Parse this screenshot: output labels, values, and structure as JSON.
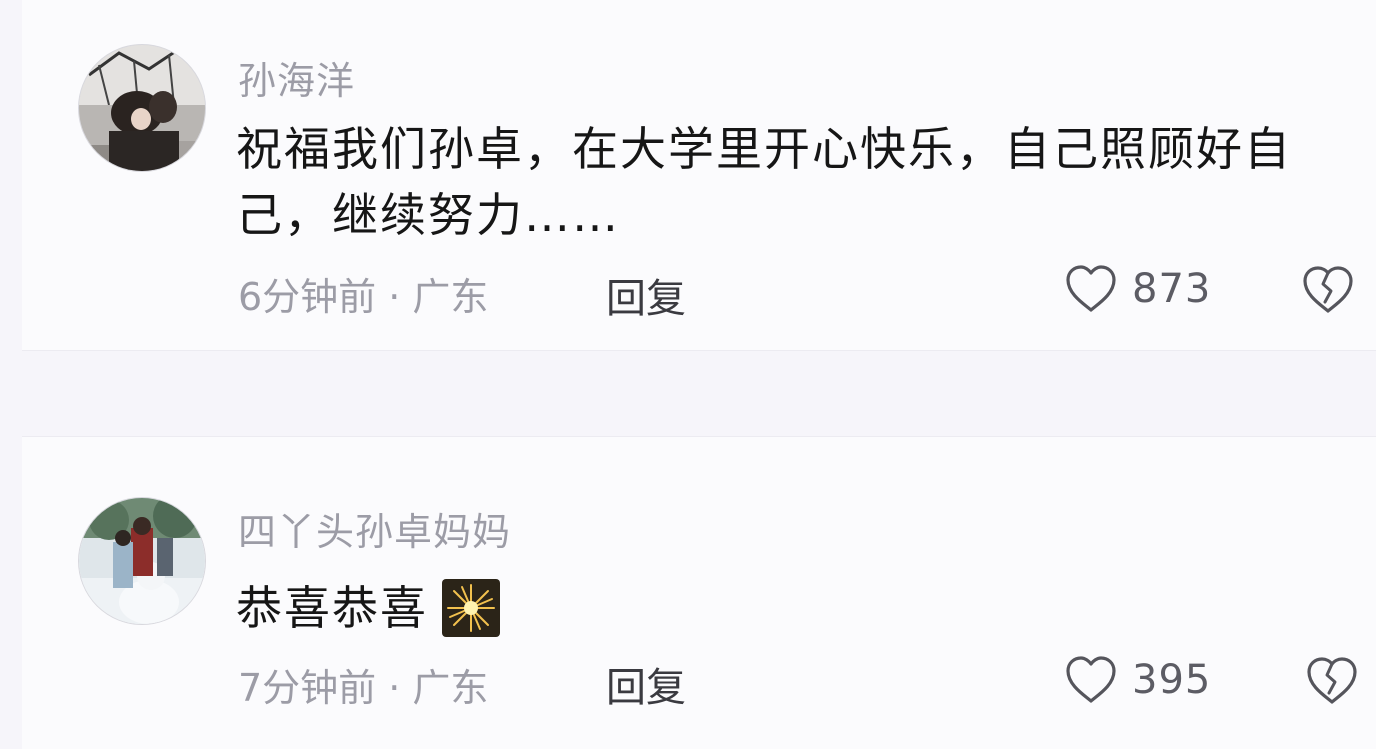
{
  "comments": [
    {
      "username": "孙海洋",
      "text": "祝福我们孙卓，在大学里开心快乐，自己照顾好自己，继续努力……",
      "meta": "6分钟前 · 广东",
      "reply_label": "回复",
      "like_count": "873",
      "avatar_icon": "photo-avatar-icon",
      "like_icon": "heart-outline-icon",
      "dislike_icon": "broken-heart-icon"
    },
    {
      "username": "四丫头孙卓妈妈",
      "text": "恭喜恭喜",
      "emoji": "firework-emoji",
      "meta": "7分钟前 · 广东",
      "reply_label": "回复",
      "like_count": "395",
      "avatar_icon": "photo-avatar-icon",
      "like_icon": "heart-outline-icon",
      "dislike_icon": "broken-heart-icon"
    }
  ],
  "colors": {
    "background": "#f6f5fa",
    "card": "#fbfbfd",
    "username": "#9c9ca6",
    "text": "#161616",
    "icon": "#55555c"
  }
}
